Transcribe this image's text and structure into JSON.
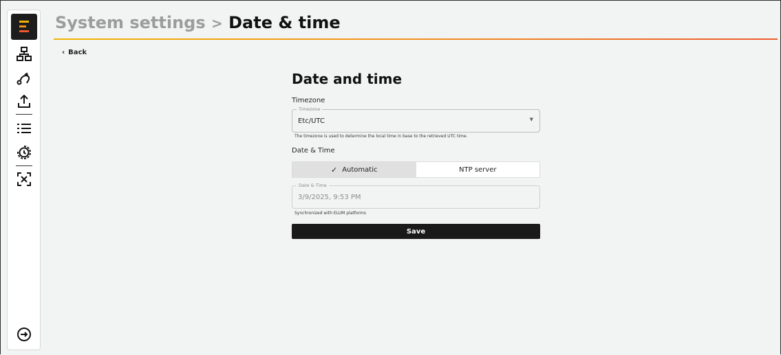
{
  "header": {
    "breadcrumb_parent": "System settings",
    "separator": ">",
    "current": "Date & time",
    "back_label": "Back",
    "accent_gradient": [
      "#f2b400",
      "#f28e1c",
      "#ee5a2e"
    ]
  },
  "sidebar": {
    "logo": "elum-logo-icon",
    "items": [
      {
        "icon": "network-icon"
      },
      {
        "icon": "route-icon"
      },
      {
        "icon": "upload-icon"
      },
      {
        "icon": "list-icon"
      },
      {
        "icon": "history-icon"
      },
      {
        "icon": "scan-icon"
      }
    ],
    "footer_icon": "logout-icon"
  },
  "form": {
    "title": "Date and time",
    "timezone_section": "Timezone",
    "timezone_legend": "Timezone",
    "timezone_value": "Etc/UTC",
    "timezone_help": "The timezone is used to determine the local time in base to the retrieved UTC time.",
    "datetime_section": "Date & Time",
    "mode_options": [
      "Automatic",
      "NTP server"
    ],
    "mode_selected": "Automatic",
    "datetime_legend": "Date & Time",
    "datetime_value": "3/9/2025, 9:53 PM",
    "datetime_help": "Synchronized with ELUM platforms",
    "save_label": "Save"
  }
}
